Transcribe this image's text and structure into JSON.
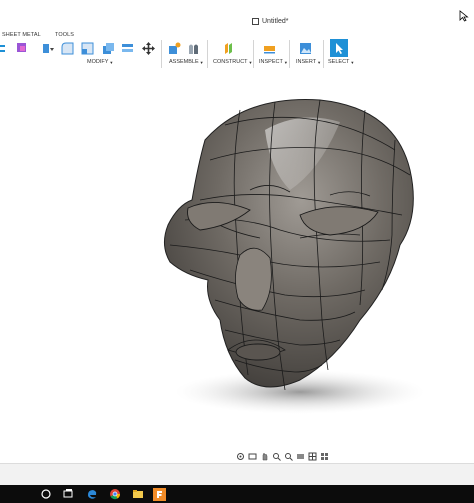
{
  "app": {
    "document_title": "Untitled*"
  },
  "toolbar": {
    "tabs": {
      "sheet_metal": "SHEET METAL",
      "tools": "TOOLS"
    },
    "groups": {
      "modify": "MODIFY",
      "assemble": "ASSEMBLE",
      "construct": "CONSTRUCT",
      "inspect": "INSPECT",
      "insert": "INSERT",
      "select": "SELECT"
    },
    "accent_color": "#1e90d6"
  },
  "viewport": {
    "model": "organic head sculpt",
    "model_color": "#6f6a64"
  },
  "taskbar": {
    "items": [
      "start-circle",
      "task-view",
      "edge",
      "chrome",
      "file-explorer",
      "fusion-app"
    ]
  }
}
